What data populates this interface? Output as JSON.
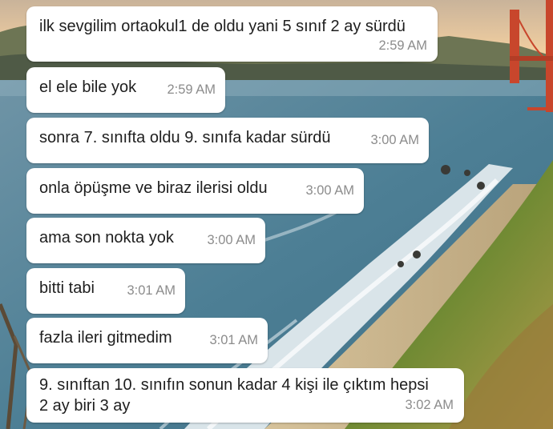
{
  "wallpaper": {
    "scene": "golden-gate-coastal-sunset-icon",
    "colors": {
      "sky": "#f4cfa0",
      "sea": "#4d7f95",
      "foam": "#f2f6f8",
      "cliff": "#7a8c38",
      "bridge": "#c8462c"
    }
  },
  "colors": {
    "bubble": "#ffffff",
    "text": "#1e1e1e",
    "timestamp": "#8c8c8c"
  },
  "messages": [
    {
      "text": "ilk sevgilim ortaokul1 de oldu yani 5 sınıf 2 ay sürdü",
      "time": "2:59 AM"
    },
    {
      "text": "el ele bile yok",
      "time": "2:59 AM"
    },
    {
      "text": "sonra 7. sınıfta oldu 9. sınıfa kadar sürdü",
      "time": "3:00 AM"
    },
    {
      "text": "onla öpüşme ve biraz ilerisi oldu",
      "time": "3:00 AM"
    },
    {
      "text": "ama son nokta yok",
      "time": "3:00 AM"
    },
    {
      "text": "bitti tabi",
      "time": "3:01 AM"
    },
    {
      "text": "fazla ileri gitmedim",
      "time": "3:01 AM"
    },
    {
      "text": "9. sınıftan 10. sınıfın sonun kadar 4 kişi ile çıktım hepsi\n2 ay biri 3 ay",
      "time": "3:02 AM"
    }
  ]
}
